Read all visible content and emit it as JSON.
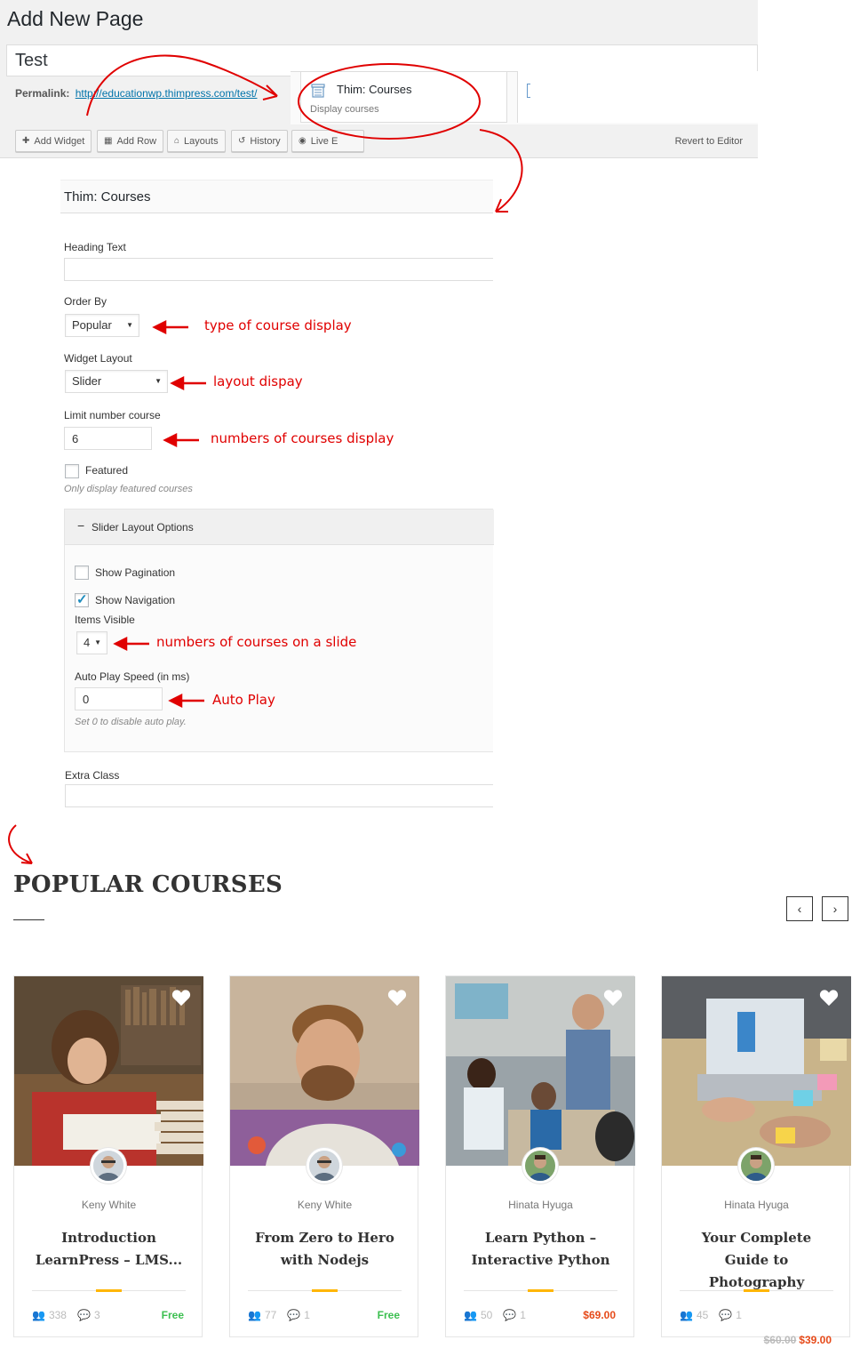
{
  "editor": {
    "heading": "Add New Page",
    "title_value": "Test",
    "permalink_label": "Permalink:",
    "permalink_url": "http://educationwp.thimpress.com/test/",
    "widget": {
      "title": "Thim: Courses",
      "description": "Display courses",
      "icon": "courses-widget-icon"
    },
    "toolbar": [
      {
        "label": "Add Widget",
        "icon": "plus-icon"
      },
      {
        "label": "Add Row",
        "icon": "grid-icon"
      },
      {
        "label": "Layouts",
        "icon": "layouts-icon"
      },
      {
        "label": "History",
        "icon": "history-icon"
      },
      {
        "label": "Live E",
        "icon": "eye-icon"
      }
    ],
    "revert_label": "Revert to Editor"
  },
  "form": {
    "title": "Thim: Courses",
    "heading_text_label": "Heading Text",
    "heading_text_value": "",
    "order_by_label": "Order By",
    "order_by_value": "Popular",
    "layout_label": "Widget Layout",
    "layout_value": "Slider",
    "limit_label": "Limit number course",
    "limit_value": "6",
    "featured_label": "Featured",
    "featured_checked": false,
    "featured_hint": "Only display featured courses",
    "slider_section_label": "Slider Layout Options",
    "pagination_label": "Show Pagination",
    "pagination_checked": false,
    "navigation_label": "Show Navigation",
    "navigation_checked": true,
    "items_visible_label": "Items Visible",
    "items_visible_value": "4",
    "autoplay_label": "Auto Play Speed (in ms)",
    "autoplay_value": "0",
    "autoplay_hint": "Set 0 to disable auto play.",
    "extra_class_label": "Extra Class",
    "extra_class_value": ""
  },
  "annotations": {
    "order_by": "type of course display",
    "layout": "layout dispay",
    "limit": "numbers of courses display",
    "items_visible": "numbers of courses on a slide",
    "autoplay": "Auto Play",
    "color": "#e00000"
  },
  "courses_section": {
    "title": "POPULAR COURSES",
    "prev_icon": "chevron-left-icon",
    "next_icon": "chevron-right-icon",
    "prev_glyph": "‹",
    "next_glyph": "›",
    "accent_color": "#ffb606",
    "courses": [
      {
        "author": "Keny White",
        "title": "Introduction LearnPress – LMS...",
        "students": "338",
        "comments": "3",
        "price": "Free",
        "old_price": ""
      },
      {
        "author": "Keny White",
        "title": "From Zero to Hero with Nodejs",
        "students": "77",
        "comments": "1",
        "price": "Free",
        "old_price": ""
      },
      {
        "author": "Hinata Hyuga",
        "title": "Learn Python – Interactive Python",
        "students": "50",
        "comments": "1",
        "price": "$69.00",
        "old_price": ""
      },
      {
        "author": "Hinata Hyuga",
        "title": "Your Complete Guide to Photography",
        "students": "45",
        "comments": "1",
        "price": "$39.00",
        "old_price": "$60.00"
      }
    ]
  }
}
